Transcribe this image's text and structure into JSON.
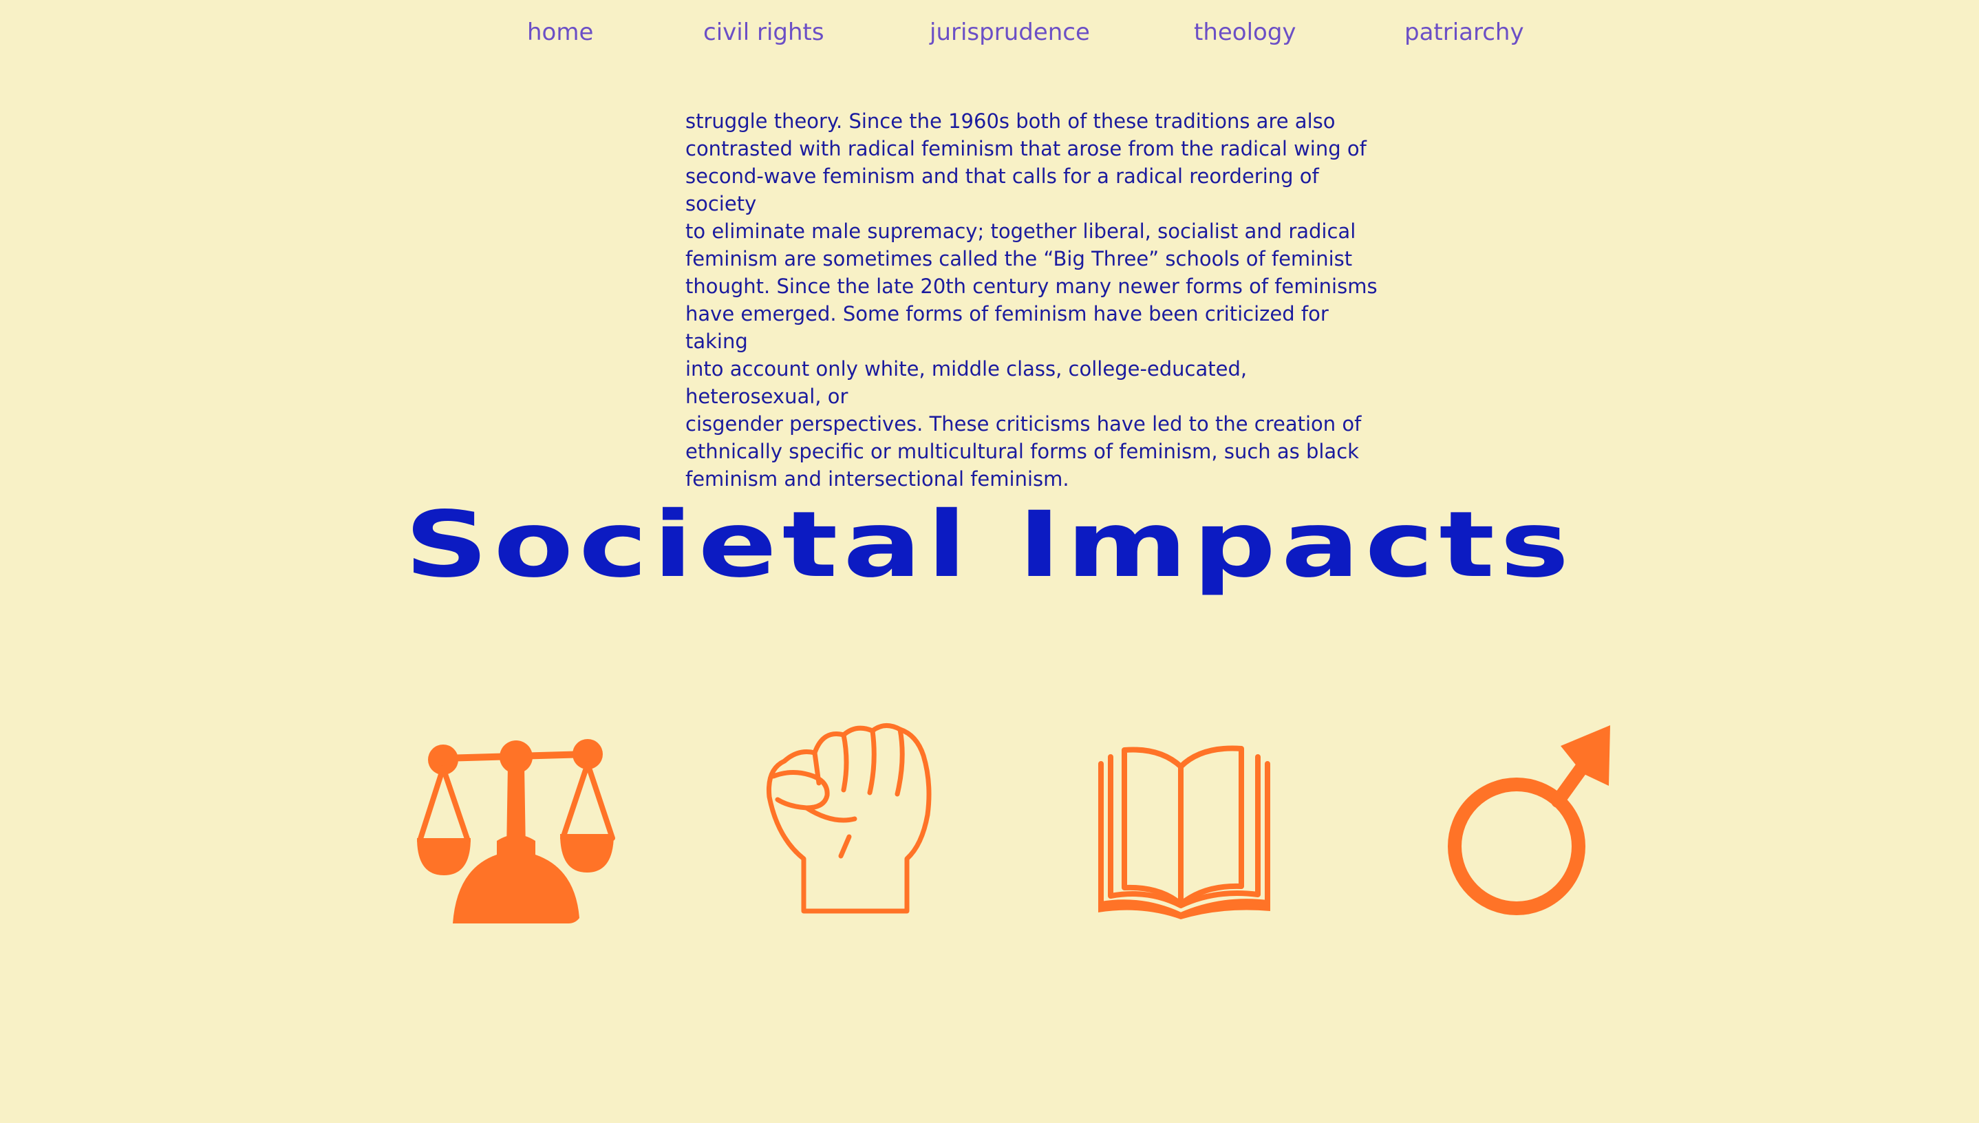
{
  "nav": {
    "items": [
      {
        "label": "home"
      },
      {
        "label": "civil rights"
      },
      {
        "label": "jurisprudence"
      },
      {
        "label": "theology"
      },
      {
        "label": "patriarchy"
      }
    ]
  },
  "main": {
    "paragraph": "struggle theory. Since the 1960s both of these traditions are also\ncontrasted with radical feminism that arose from the radical wing of\nsecond-wave feminism and that calls for a radical reordering of society\nto eliminate male supremacy; together liberal, socialist and radical\nfeminism are sometimes called the “Big Three” schools of feminist\nthought. Since the late 20th century many newer forms of feminisms\nhave emerged. Some forms of feminism have been criticized for taking\ninto account only white, middle class, college-educated, heterosexual, or\ncisgender perspectives. These criticisms have led to the creation of\nethnically specific or multicultural forms of feminism, such as black\nfeminism and intersectional feminism.",
    "heading": "Societal Impacts"
  },
  "icons": [
    {
      "name": "scales-of-justice-icon"
    },
    {
      "name": "raised-fist-icon"
    },
    {
      "name": "open-book-icon"
    },
    {
      "name": "male-symbol-icon"
    }
  ],
  "colors": {
    "background": "#F8F1C6",
    "nav": "#6B4FC6",
    "text": "#1B1B9E",
    "heading": "#0C1BC2",
    "icon": "#FF7327"
  }
}
